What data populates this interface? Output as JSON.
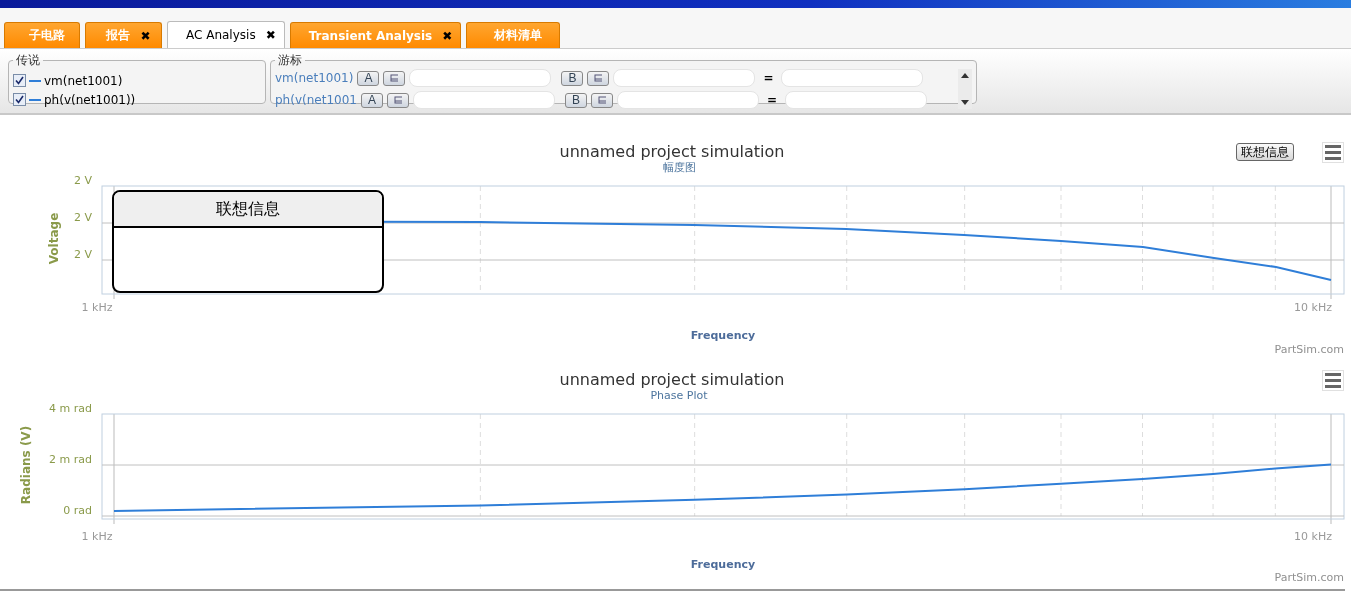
{
  "tabs": [
    {
      "label": "子电路",
      "selected": false
    },
    {
      "label": "报告",
      "selected": false,
      "close": "✖"
    },
    {
      "label": "AC Analysis",
      "selected": true,
      "close": "✖"
    },
    {
      "label": "Transient Analysis",
      "selected": false,
      "close": "✖"
    },
    {
      "label": "材料清单",
      "selected": false
    }
  ],
  "legend": {
    "title": "传说",
    "items": [
      {
        "label": "vm(net1001)",
        "checked": true
      },
      {
        "label": "ph(v(net1001))",
        "checked": true
      }
    ]
  },
  "cursors": {
    "title": "游标",
    "rows": [
      {
        "signal": "vm(net1001)",
        "button_a": "A",
        "button_b": "B",
        "equals": "="
      },
      {
        "signal": "ph(v(net1001",
        "button_a": "A",
        "button_b": "B",
        "equals": "="
      }
    ]
  },
  "magnitude_chart": {
    "title": "unnamed project simulation",
    "subtitle": "幅度图",
    "ylabel": "Voltage",
    "xlabel": "Frequency",
    "y_tick_labels": [
      "2 V",
      "2 V",
      "2 V"
    ],
    "x_tick_labels": [
      "1 kHz",
      "10 kHz"
    ],
    "info_button": "联想信息",
    "credit": "PartSim.com",
    "tooltip": {
      "title": "联想信息"
    }
  },
  "phase_chart": {
    "title": "unnamed project simulation",
    "subtitle": "Phase Plot",
    "ylabel": "Radians (V)",
    "xlabel": "Frequency",
    "y_tick_labels": [
      "4 m rad",
      "2 m rad",
      "0 rad"
    ],
    "x_tick_labels": [
      "1 kHz",
      "10 kHz"
    ],
    "credit": "PartSim.com"
  }
}
